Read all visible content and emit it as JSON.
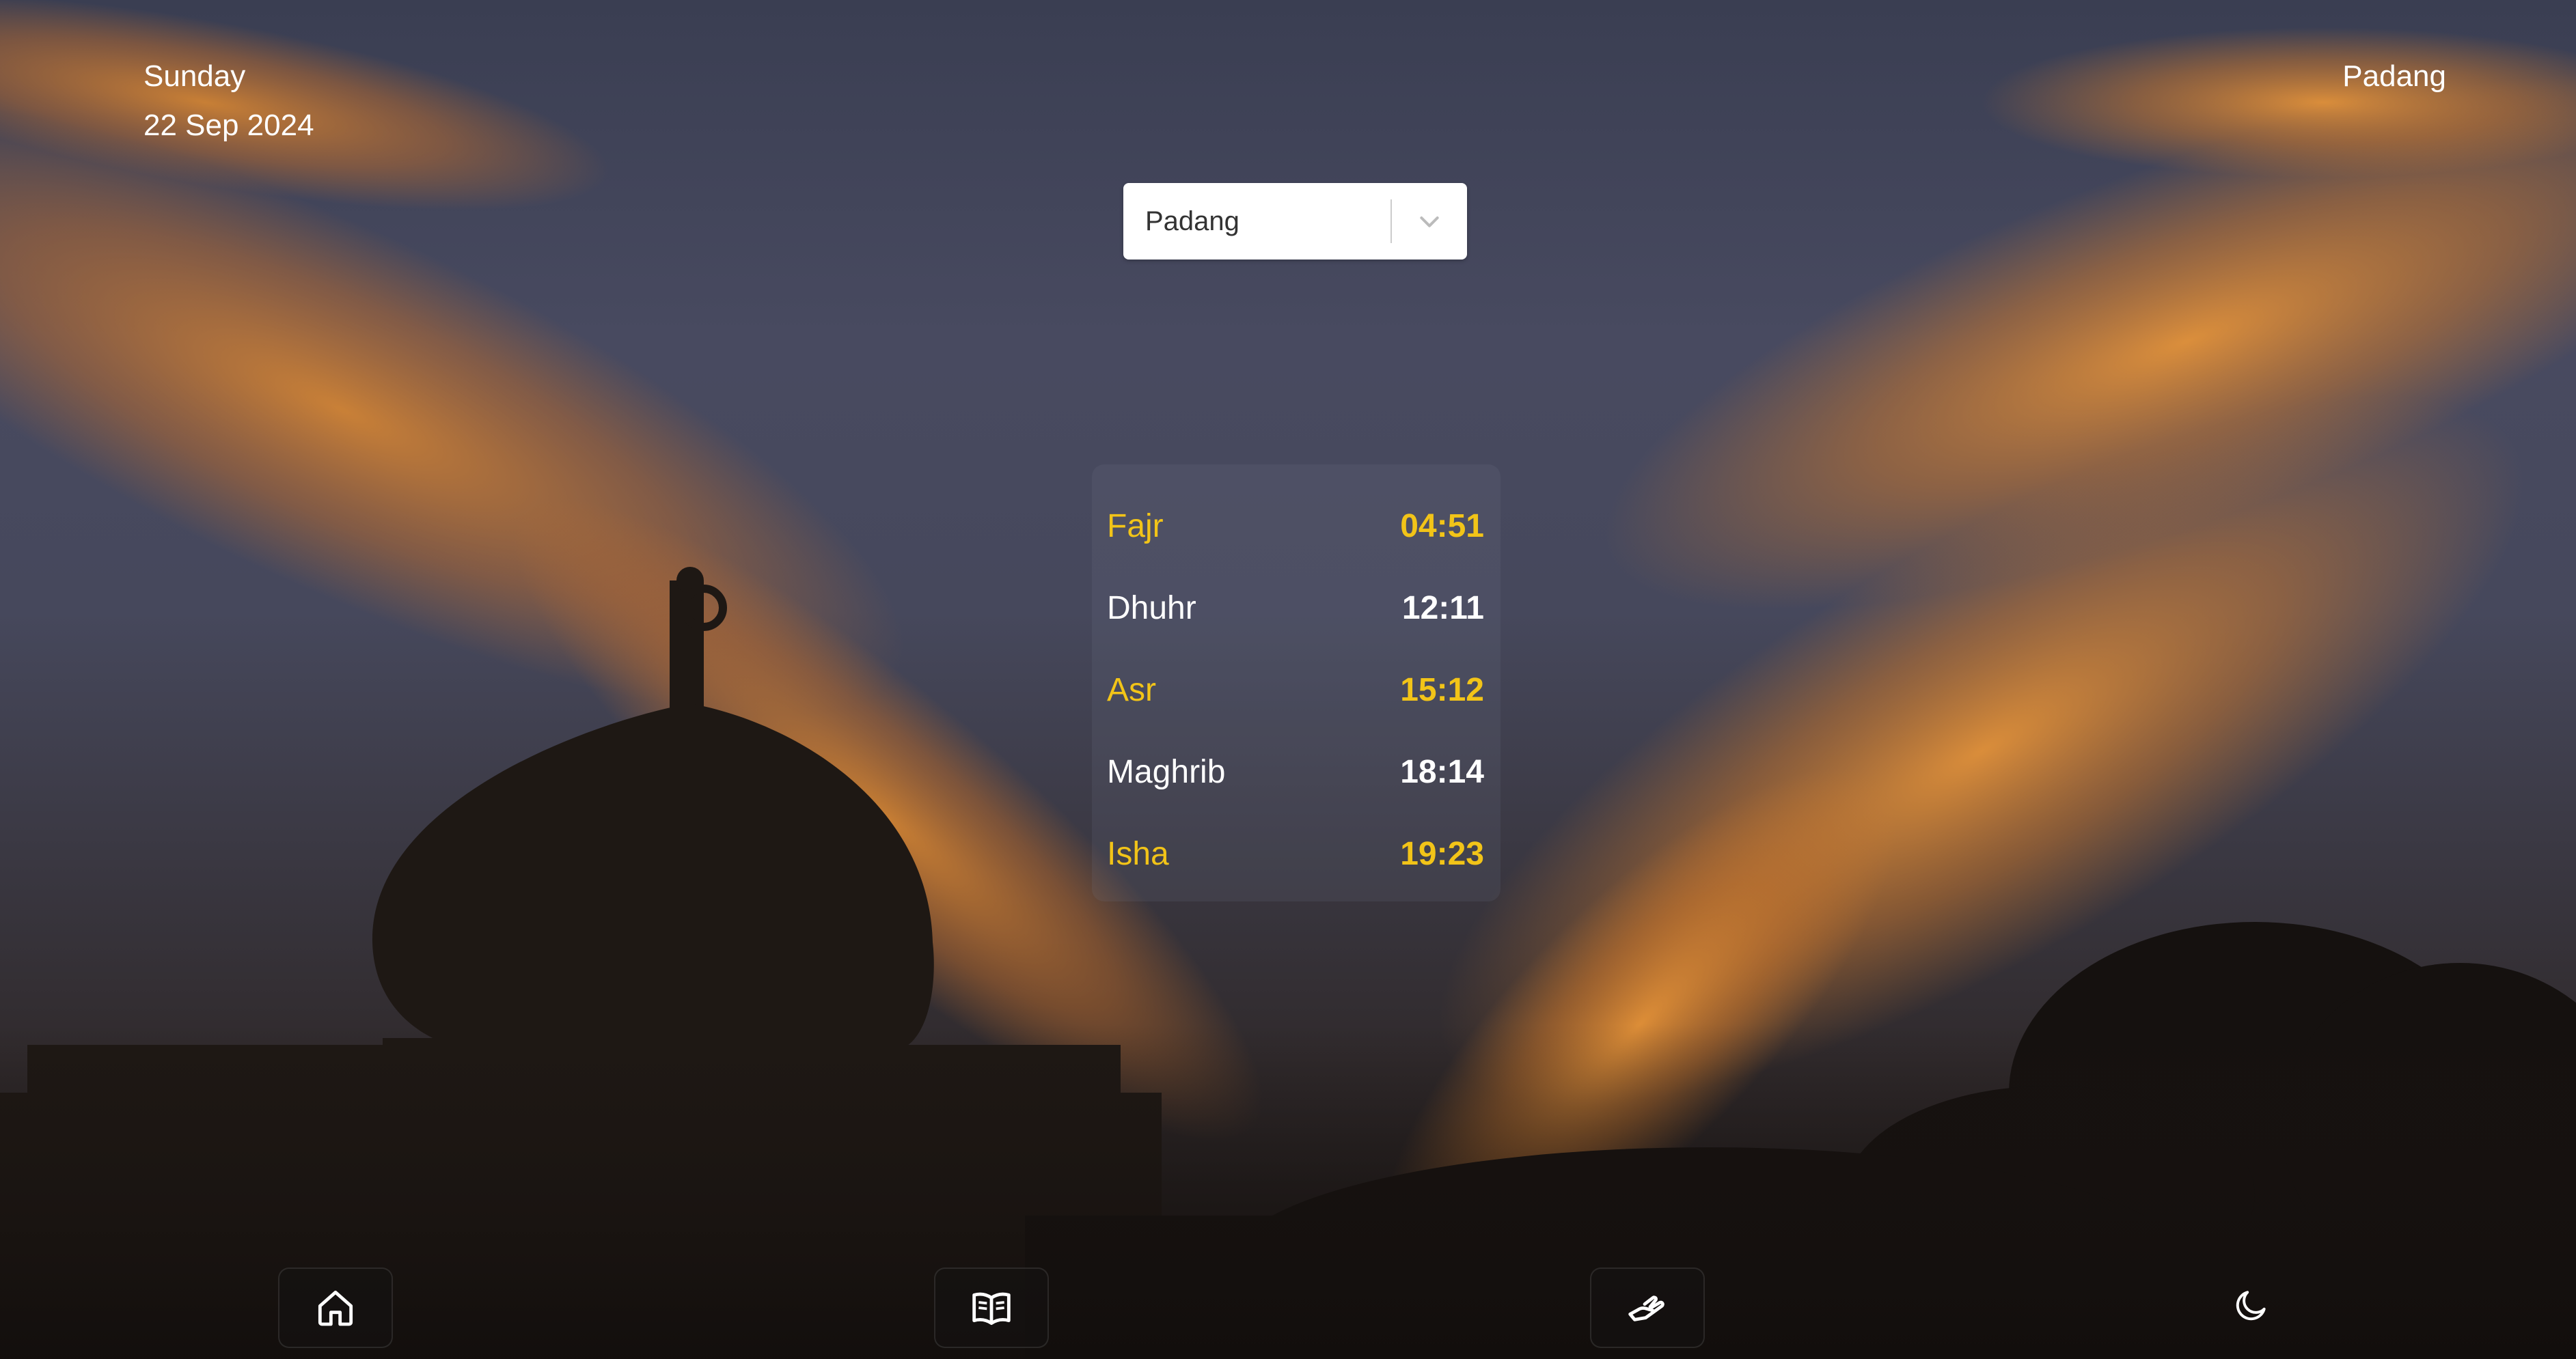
{
  "header": {
    "day": "Sunday",
    "date": "22 Sep 2024",
    "city": "Padang"
  },
  "city_select": {
    "selected": "Padang",
    "icon": "chevron-down-icon"
  },
  "prayer_times": [
    {
      "name": "Fajr",
      "time": "04:51",
      "highlight": true
    },
    {
      "name": "Dhuhr",
      "time": "12:11",
      "highlight": false
    },
    {
      "name": "Asr",
      "time": "15:12",
      "highlight": true
    },
    {
      "name": "Maghrib",
      "time": "18:14",
      "highlight": false
    },
    {
      "name": "Isha",
      "time": "19:23",
      "highlight": true
    }
  ],
  "bottom_nav": {
    "items": [
      {
        "icon": "home-icon"
      },
      {
        "icon": "open-book-icon"
      },
      {
        "icon": "hand-icon"
      },
      {
        "icon": "moon-icon"
      }
    ]
  },
  "colors": {
    "highlight": "#f2c418",
    "text": "#ffffff",
    "sky": "#464a5e",
    "cloud_orange": "#d9822b"
  }
}
